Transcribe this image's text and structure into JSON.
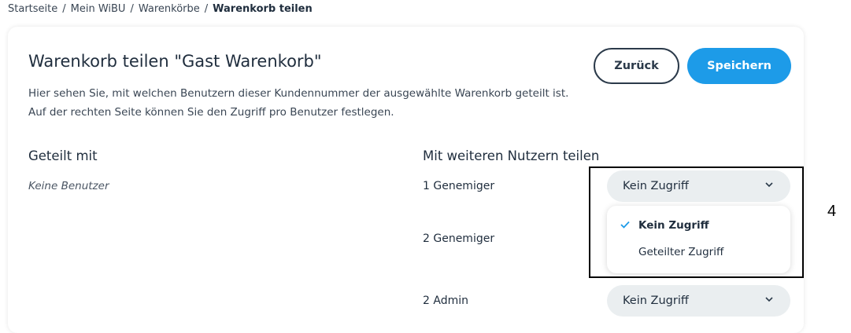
{
  "breadcrumb": {
    "items": [
      "Startseite",
      "Mein WiBU",
      "Warenkörbe"
    ],
    "current": "Warenkorb teilen",
    "separator": "/"
  },
  "page": {
    "title": "Warenkorb teilen \"Gast Warenkorb\"",
    "description": "Hier sehen Sie, mit welchen Benutzern dieser Kundennummer der ausgewählte Warenkorb geteilt ist. Auf der rechten Seite können Sie den Zugriff pro Benutzer festlegen."
  },
  "buttons": {
    "back": "Zurück",
    "save": "Speichern"
  },
  "shared_with": {
    "heading": "Geteilt mit",
    "empty_text": "Keine Benutzer"
  },
  "share_more": {
    "heading": "Mit weiteren Nutzern teilen",
    "users": [
      {
        "name": "1 Genemiger",
        "access": "Kein Zugriff",
        "open": true
      },
      {
        "name": "2 Genemiger",
        "access": null,
        "open": false
      },
      {
        "name": "2 Admin",
        "access": "Kein Zugriff",
        "open": false
      }
    ]
  },
  "dropdown_options": [
    {
      "label": "Kein Zugriff",
      "selected": true
    },
    {
      "label": "Geteilter Zugriff",
      "selected": false
    }
  ],
  "annotation": {
    "marker": "4"
  },
  "colors": {
    "primary": "#1d9be8",
    "select_bg": "#eaeef0",
    "text_dark": "#1f2d3d"
  }
}
